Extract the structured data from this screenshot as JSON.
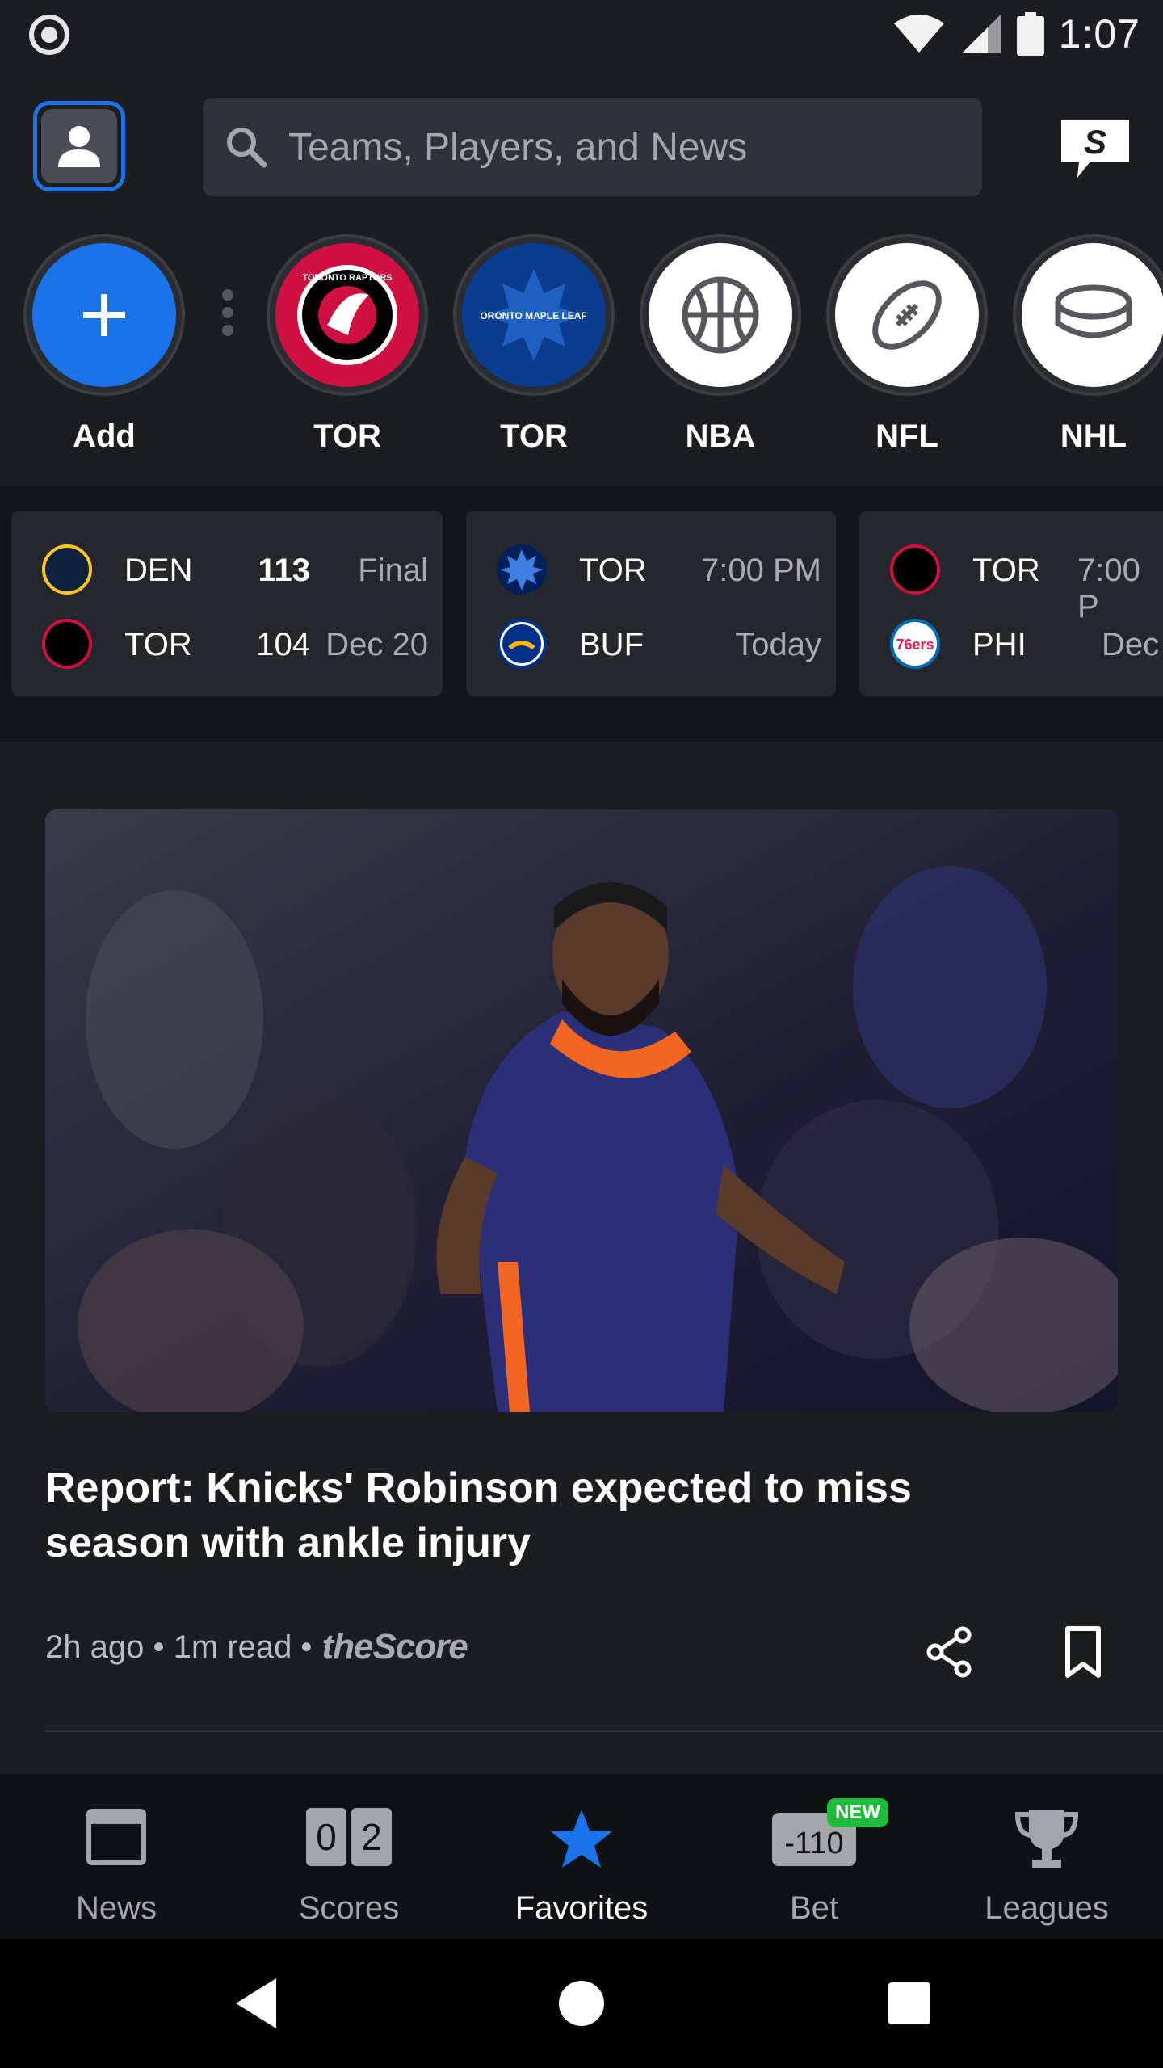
{
  "status_bar": {
    "time": "1:07"
  },
  "search": {
    "placeholder": "Teams, Players, and News"
  },
  "favorites": [
    {
      "label": "Add",
      "icon": "plus-icon"
    },
    {
      "label": "TOR",
      "icon": "raptors-logo-icon"
    },
    {
      "label": "TOR",
      "icon": "maple-leafs-logo-icon"
    },
    {
      "label": "NBA",
      "icon": "basketball-icon"
    },
    {
      "label": "NFL",
      "icon": "football-icon"
    },
    {
      "label": "NHL",
      "icon": "hockey-puck-icon"
    }
  ],
  "games": [
    {
      "team1": "DEN",
      "score1": "113",
      "status1": "Final",
      "team2": "TOR",
      "score2": "104",
      "status2": "Dec 20"
    },
    {
      "team1": "TOR",
      "time": "7:00 PM",
      "team2": "BUF",
      "day": "Today"
    },
    {
      "team1": "TOR",
      "time": "7:00 P",
      "team2": "PHI",
      "day": "Dec"
    }
  ],
  "logos": {
    "raptors_text": "TORONTO RAPTORS",
    "leafs_text": "TORONTO MAPLE LEAFS",
    "sixers_text": "76ers"
  },
  "article": {
    "headline": "Report: Knicks' Robinson expected to miss season with ankle injury",
    "meta": "2h ago • 1m read •",
    "source": "theScore"
  },
  "bottom_nav": {
    "news": "News",
    "scores": "Scores",
    "scores_icon_digits": [
      "0",
      "2"
    ],
    "favorites": "Favorites",
    "bet": "Bet",
    "bet_icon_text": "-110",
    "bet_badge": "NEW",
    "leagues": "Leagues"
  },
  "colors": {
    "accent_blue": "#1a73e8",
    "raptors_red": "#ce1141",
    "leafs_blue": "#00205b",
    "new_badge_green": "#1fbb3b"
  }
}
